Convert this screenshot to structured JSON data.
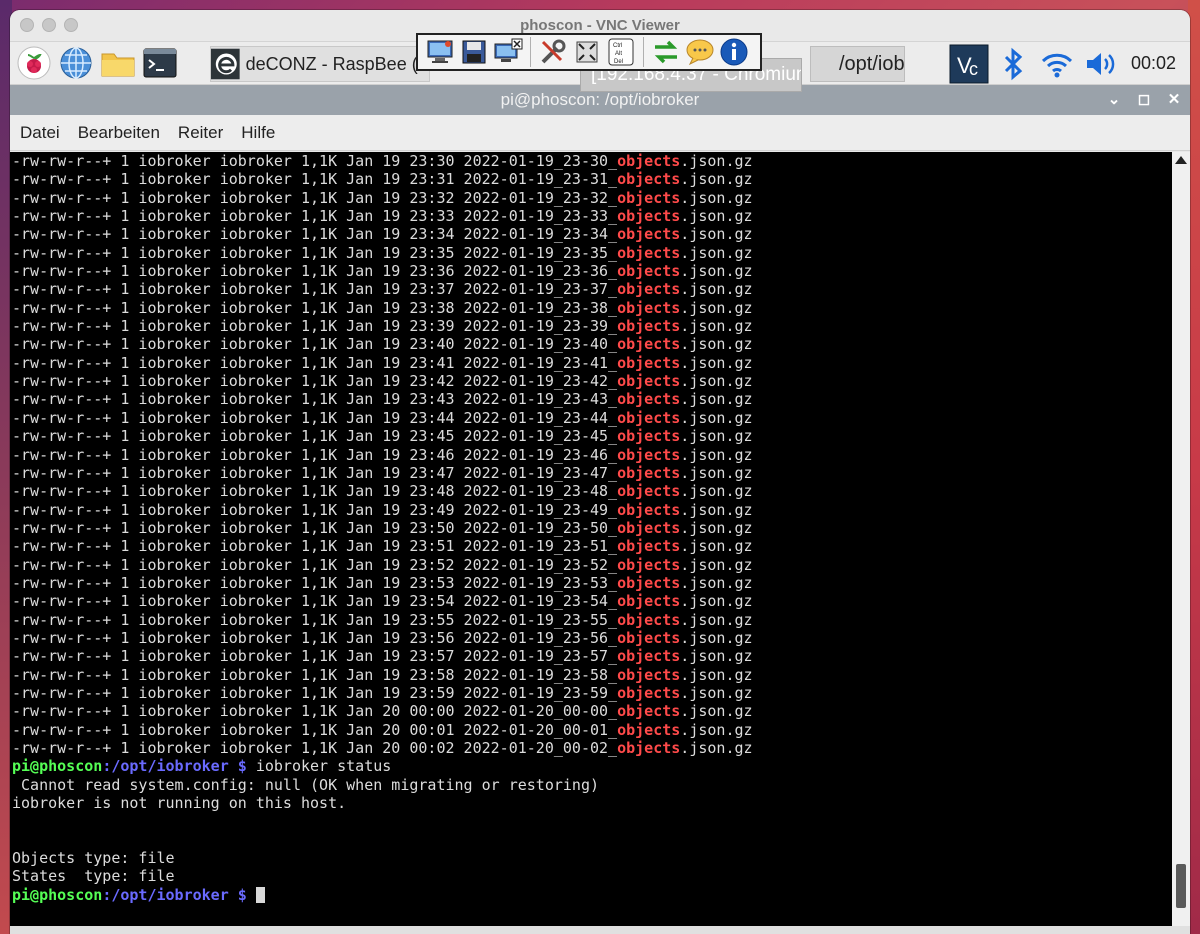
{
  "window": {
    "title": "phoscon - VNC Viewer"
  },
  "panel": {
    "task1_label": "deCONZ - RaspBee (/...",
    "task2_label": "/opt/iob...",
    "clock": "00:02"
  },
  "vnc_toolbar": {
    "icons": [
      "monitor-icon",
      "save-icon",
      "close-connection-icon",
      "options-icon",
      "fullscreen-icon",
      "ctrl-alt-del-icon",
      "transfer-icon",
      "chat-icon",
      "info-icon"
    ],
    "ctrl_alt_del_text": "Ctrl Alt Del"
  },
  "tooltip": "[192.168.4.37 - Chromium]",
  "terminal_window": {
    "title": "pi@phoscon: /opt/iobroker",
    "menu": [
      "Datei",
      "Bearbeiten",
      "Reiter",
      "Hilfe"
    ]
  },
  "file_listing": {
    "perms": "-rw-rw-r--+ 1 iobroker iobroker 1,1K",
    "highlight": "objects",
    "suffix": ".json.gz",
    "rows": [
      {
        "date": "Jan 19 23:30",
        "name_prefix": "2022-01-19_23-30_"
      },
      {
        "date": "Jan 19 23:31",
        "name_prefix": "2022-01-19_23-31_"
      },
      {
        "date": "Jan 19 23:32",
        "name_prefix": "2022-01-19_23-32_"
      },
      {
        "date": "Jan 19 23:33",
        "name_prefix": "2022-01-19_23-33_"
      },
      {
        "date": "Jan 19 23:34",
        "name_prefix": "2022-01-19_23-34_"
      },
      {
        "date": "Jan 19 23:35",
        "name_prefix": "2022-01-19_23-35_"
      },
      {
        "date": "Jan 19 23:36",
        "name_prefix": "2022-01-19_23-36_"
      },
      {
        "date": "Jan 19 23:37",
        "name_prefix": "2022-01-19_23-37_"
      },
      {
        "date": "Jan 19 23:38",
        "name_prefix": "2022-01-19_23-38_"
      },
      {
        "date": "Jan 19 23:39",
        "name_prefix": "2022-01-19_23-39_"
      },
      {
        "date": "Jan 19 23:40",
        "name_prefix": "2022-01-19_23-40_"
      },
      {
        "date": "Jan 19 23:41",
        "name_prefix": "2022-01-19_23-41_"
      },
      {
        "date": "Jan 19 23:42",
        "name_prefix": "2022-01-19_23-42_"
      },
      {
        "date": "Jan 19 23:43",
        "name_prefix": "2022-01-19_23-43_"
      },
      {
        "date": "Jan 19 23:44",
        "name_prefix": "2022-01-19_23-44_"
      },
      {
        "date": "Jan 19 23:45",
        "name_prefix": "2022-01-19_23-45_"
      },
      {
        "date": "Jan 19 23:46",
        "name_prefix": "2022-01-19_23-46_"
      },
      {
        "date": "Jan 19 23:47",
        "name_prefix": "2022-01-19_23-47_"
      },
      {
        "date": "Jan 19 23:48",
        "name_prefix": "2022-01-19_23-48_"
      },
      {
        "date": "Jan 19 23:49",
        "name_prefix": "2022-01-19_23-49_"
      },
      {
        "date": "Jan 19 23:50",
        "name_prefix": "2022-01-19_23-50_"
      },
      {
        "date": "Jan 19 23:51",
        "name_prefix": "2022-01-19_23-51_"
      },
      {
        "date": "Jan 19 23:52",
        "name_prefix": "2022-01-19_23-52_"
      },
      {
        "date": "Jan 19 23:53",
        "name_prefix": "2022-01-19_23-53_"
      },
      {
        "date": "Jan 19 23:54",
        "name_prefix": "2022-01-19_23-54_"
      },
      {
        "date": "Jan 19 23:55",
        "name_prefix": "2022-01-19_23-55_"
      },
      {
        "date": "Jan 19 23:56",
        "name_prefix": "2022-01-19_23-56_"
      },
      {
        "date": "Jan 19 23:57",
        "name_prefix": "2022-01-19_23-57_"
      },
      {
        "date": "Jan 19 23:58",
        "name_prefix": "2022-01-19_23-58_"
      },
      {
        "date": "Jan 19 23:59",
        "name_prefix": "2022-01-19_23-59_"
      },
      {
        "date": "Jan 20 00:00",
        "name_prefix": "2022-01-20_00-00_"
      },
      {
        "date": "Jan 20 00:01",
        "name_prefix": "2022-01-20_00-01_"
      },
      {
        "date": "Jan 20 00:02",
        "name_prefix": "2022-01-20_00-02_"
      }
    ]
  },
  "prompt": {
    "user_host": "pi@phoscon",
    "path": ":/opt/iobroker",
    "symbol": " $ "
  },
  "command": "iobroker status",
  "output": [
    " Cannot read system.config: null (OK when migrating or restoring)",
    "iobroker is not running on this host.",
    "",
    "",
    "Objects type: file",
    "States  type: file"
  ],
  "colors": {
    "highlight_red": "#ff4a4a",
    "prompt_green": "#55ff55",
    "prompt_blue": "#6a6aff",
    "terminal_bg": "#000000",
    "terminal_fg": "#dcdcdc"
  }
}
